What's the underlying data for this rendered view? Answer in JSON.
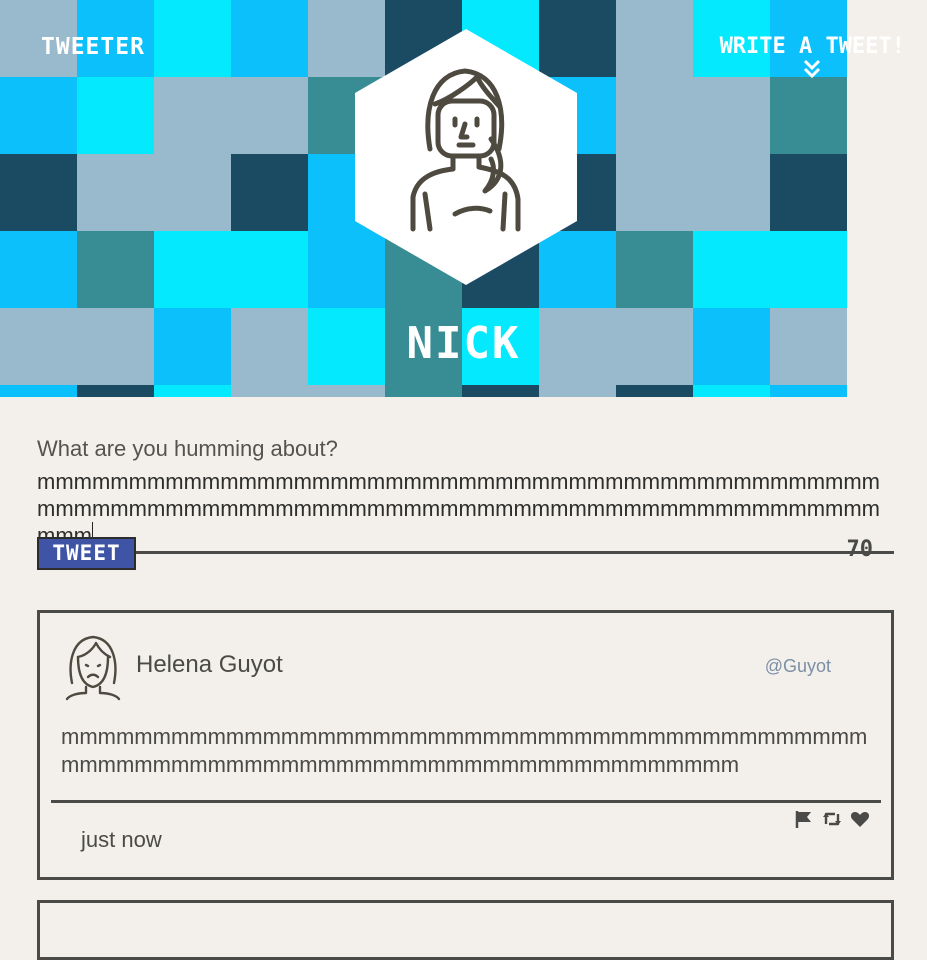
{
  "header": {
    "brand": "TWEETER",
    "compose_link": "WRITE A TWEET!",
    "username": "NICK"
  },
  "composer": {
    "label": "What are you humming about?",
    "value": "mmmmmmmmmmmmmmmmmmmmmmmmmmmmmmmmmmmmmmmmmmmmmmmmmmmmmmmmmmmmmmmmmmmmmmmmmmmmmmmmmmmmmmmmmmmmmmm",
    "button_label": "TWEET",
    "char_count": "70"
  },
  "tweets": [
    {
      "name": "Helena Guyot",
      "handle": "@Guyot",
      "body": "mmmmmmmmmmmmmmmmmmmmmmmmmmmmmmmmmmmmmmmmmmmmmmmmmmmmmmmmmmmmmmmmmmmmmmmmmmmmmmmmm",
      "time": "just now",
      "icons": [
        "flag-icon",
        "retweet-icon",
        "heart-icon"
      ]
    }
  ],
  "colors": {
    "background": "#f3f0eb",
    "text": "#4a4a48",
    "button": "#4054a6",
    "handle": "#7c8fa6",
    "tile_palette": [
      "#1b4a63",
      "#0bc0fb",
      "#05e9ff",
      "#99b9cc",
      "#388c94",
      "#8ec6e4"
    ]
  }
}
